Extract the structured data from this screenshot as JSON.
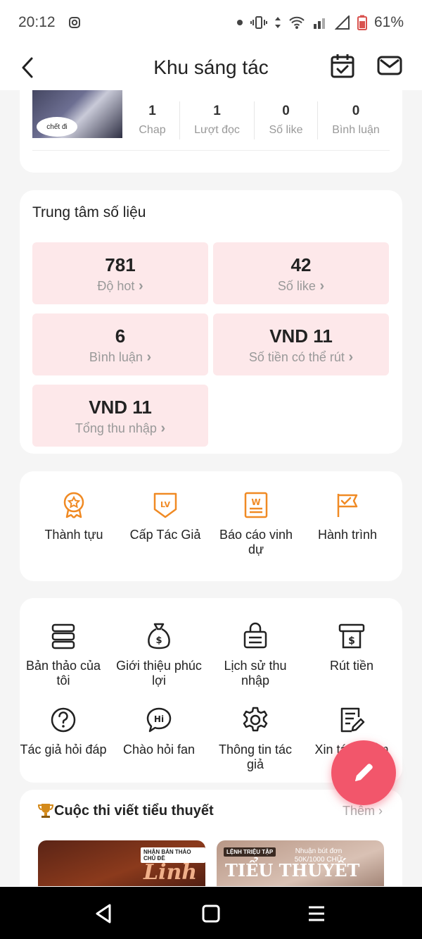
{
  "status_bar": {
    "time": "20:12",
    "battery": "61%"
  },
  "header": {
    "title": "Khu sáng tác"
  },
  "work": {
    "thumb_caption": "chết đi",
    "stats": [
      {
        "value": "1",
        "label": "Chap"
      },
      {
        "value": "1",
        "label": "Lượt đọc"
      },
      {
        "value": "0",
        "label": "Số like"
      },
      {
        "value": "0",
        "label": "Bình luận"
      }
    ]
  },
  "data_center": {
    "title": "Trung tâm số liệu",
    "tiles": [
      {
        "value": "781",
        "label": "Độ hot"
      },
      {
        "value": "42",
        "label": "Số like"
      },
      {
        "value": "6",
        "label": "Bình luận"
      },
      {
        "value": "VND 11",
        "label": "Số tiền có thể rút"
      },
      {
        "value": "VND 11",
        "label": "Tổng thu nhập"
      }
    ]
  },
  "achievements": [
    {
      "label": "Thành tựu",
      "icon": "medal-icon"
    },
    {
      "label": "Cấp Tác Giả",
      "icon": "level-badge-icon"
    },
    {
      "label": "Báo cáo vinh dự",
      "icon": "honor-report-icon"
    },
    {
      "label": "Hành trình",
      "icon": "journey-flag-icon"
    }
  ],
  "tools": [
    {
      "label": "Bản thảo của tôi",
      "icon": "drafts-icon"
    },
    {
      "label": "Giới thiệu phúc lợi",
      "icon": "money-bag-icon"
    },
    {
      "label": "Lịch sử thu nhập",
      "icon": "income-history-icon"
    },
    {
      "label": "Rút tiền",
      "icon": "withdraw-icon"
    },
    {
      "label": "Tác giả hỏi đáp",
      "icon": "question-icon"
    },
    {
      "label": "Chào hỏi fan",
      "icon": "hi-bubble-icon"
    },
    {
      "label": "Thông tin tác giả",
      "icon": "settings-gear-icon"
    },
    {
      "label": "Xin tác phẩm",
      "icon": "apply-document-icon"
    }
  ],
  "contest": {
    "title": "Cuộc thi viết tiểu thuyết",
    "more": "Thêm",
    "banners": [
      {
        "tag": "NHẬN BẢN THẢO CHỦ ĐỀ",
        "headline": "Linh dị"
      },
      {
        "tag": "LỆNH TRIỆU TẬP",
        "headline": "TIỂU THUYẾT",
        "note": "Nhuận bút đơn 50K/1000 CHỮ"
      }
    ]
  },
  "colors": {
    "accent": "#f2566b",
    "tile_bg": "#fde8ea",
    "icon_orange": "#f08a24"
  }
}
